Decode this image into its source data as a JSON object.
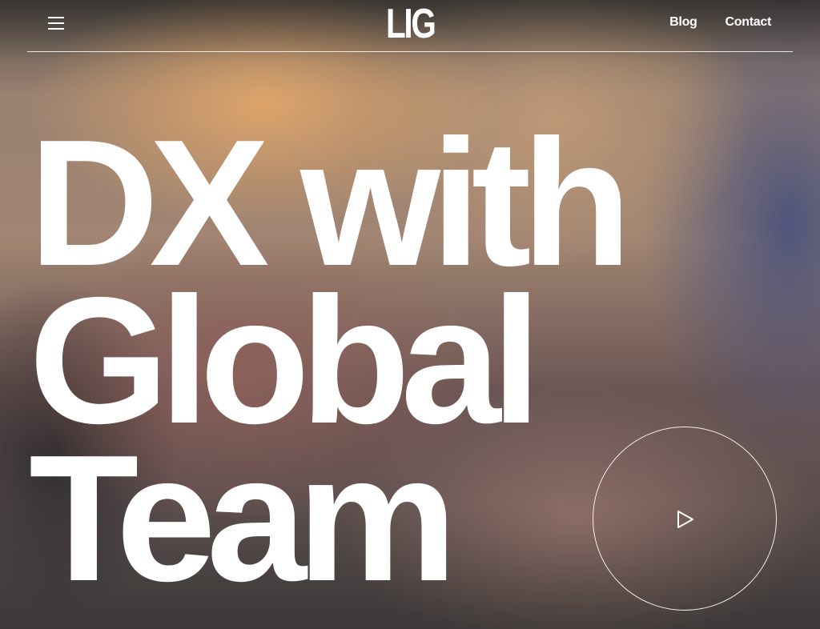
{
  "header": {
    "menu_icon": "hamburger-icon",
    "logo_text": "LIG",
    "nav": [
      {
        "label": "Blog"
      },
      {
        "label": "Contact"
      }
    ]
  },
  "hero": {
    "headline_lines": [
      "DX with",
      "Global",
      "Team"
    ],
    "play_icon": "play-icon"
  },
  "colors": {
    "text": "#ffffff",
    "rule": "#ffffff"
  }
}
